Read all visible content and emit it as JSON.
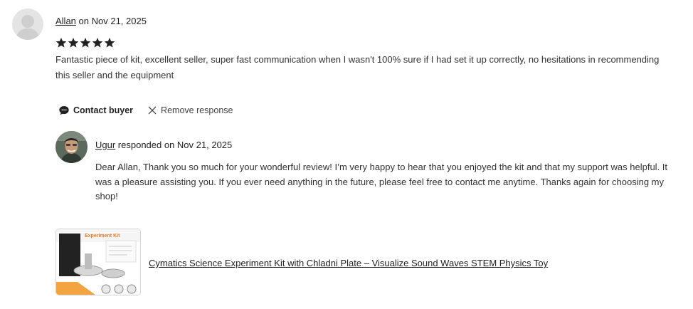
{
  "review": {
    "reviewer_name": "Allan",
    "date_text": " on Nov 21, 2025",
    "rating": 5,
    "text": "Fantastic piece of kit, excellent seller, super fast communication when I wasn't 100% sure if I had set it up correctly, no hesitations in recommending this seller and the equipment"
  },
  "actions": {
    "contact_label": "Contact buyer",
    "remove_label": "Remove response"
  },
  "response": {
    "seller_name": "Ugur",
    "meta_text": " responded on Nov 21, 2025",
    "text": "Dear Allan, Thank you so much for your wonderful review! I’m very happy to hear that you enjoyed the kit and that my support was helpful. It was a pleasure assisting you. If you ever need anything in the future, please feel free to contact me anytime. Thanks again for choosing my shop!"
  },
  "product": {
    "title": "Cymatics Science Experiment Kit with Chladni Plate – Visualize Sound Waves STEM Physics Toy",
    "thumb_label": "Experiment Kit"
  },
  "colors": {
    "text": "#222222",
    "star": "#222222",
    "avatar_placeholder": "#e4e4e4",
    "thumb_accent": "#f3a340"
  }
}
